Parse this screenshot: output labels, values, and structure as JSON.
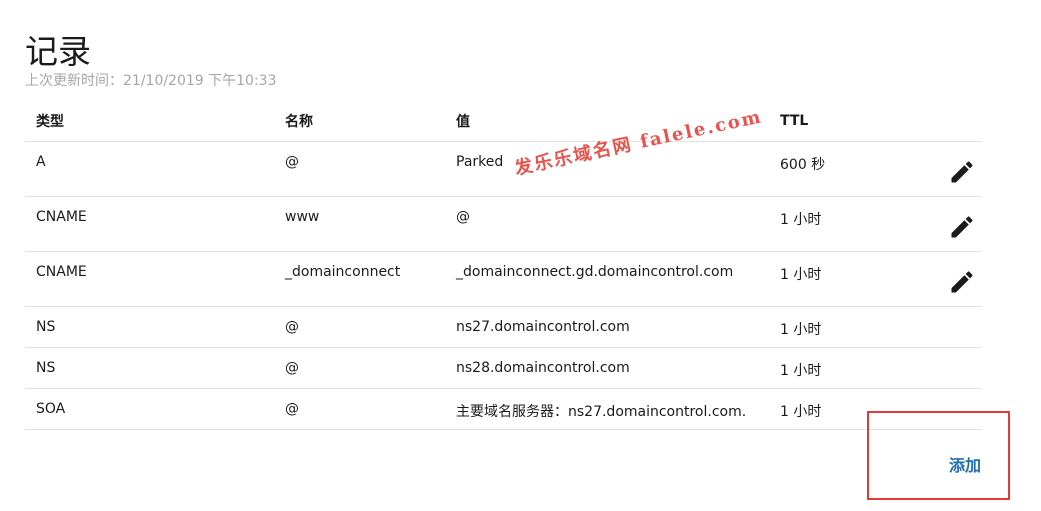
{
  "page": {
    "title": "记录",
    "last_updated": "上次更新时间：21/10/2019 下午10:33"
  },
  "table": {
    "headers": [
      "类型",
      "名称",
      "值",
      "TTL"
    ],
    "rows": [
      {
        "type": "A",
        "name": "@",
        "value": "Parked",
        "ttl": "600 秒",
        "editable": true
      },
      {
        "type": "CNAME",
        "name": "www",
        "value": "@",
        "ttl": "1 小时",
        "editable": true
      },
      {
        "type": "CNAME",
        "name": "_domainconnect",
        "value": "_domainconnect.gd.domaincontrol.com",
        "ttl": "1 小时",
        "editable": true
      },
      {
        "type": "NS",
        "name": "@",
        "value": "ns27.domaincontrol.com",
        "ttl": "1 小时",
        "editable": false
      },
      {
        "type": "NS",
        "name": "@",
        "value": "ns28.domaincontrol.com",
        "ttl": "1 小时",
        "editable": false
      },
      {
        "type": "SOA",
        "name": "@",
        "value": "主要域名服务器：ns27.domaincontrol.com.",
        "ttl": "1 小时",
        "editable": false
      }
    ]
  },
  "actions": {
    "add_label": "添加",
    "edit_icon": "pencil-icon"
  },
  "watermark": {
    "text": "发乐乐域名网 falele.com"
  },
  "colors": {
    "link": "#1f6db3",
    "highlight": "#e53935",
    "muted_text": "#a6a6a6",
    "watermark": "#e8534d"
  }
}
